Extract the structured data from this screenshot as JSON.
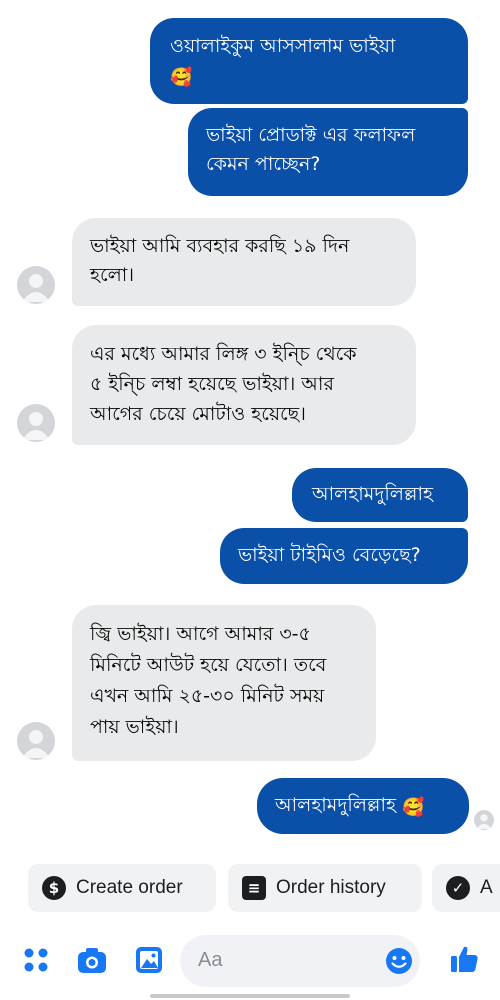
{
  "messages": [
    {
      "dir": "out",
      "text": "ওয়ালাইকুম আসসালাম ভাইয়া",
      "emoji": "🥰"
    },
    {
      "dir": "out",
      "lines": [
        "ভাইয়া প্রোডাক্ট এর ফলাফল",
        "কেমন পাচ্ছেন?"
      ]
    },
    {
      "dir": "in",
      "lines": [
        "ভাইয়া আমি ব্যবহার করছি ১৯ দিন",
        "হলো।"
      ]
    },
    {
      "dir": "in",
      "lines": [
        "এর মধ্যে আমার লিঙ্গ ৩ ইন্চি থেকে",
        "৫ ইন্চি লম্বা হয়েছে ভাইয়া। আর",
        "আগের চেয়ে মোটাও হয়েছে।"
      ]
    },
    {
      "dir": "out",
      "text": "আলহামদুলিল্লাহ"
    },
    {
      "dir": "out",
      "text": "ভাইয়া টাইমিও বেড়েছে?"
    },
    {
      "dir": "in",
      "lines": [
        "জ্বি ভাইয়া। আগে আমার ৩-৫",
        "মিনিটে আউট হয়ে যেতো। তবে",
        "এখন আমি ২৫-৩০ মিনিট সময়",
        "পায় ভাইয়া।"
      ]
    },
    {
      "dir": "out",
      "text": "আলহামদুলিল্লাহ",
      "emoji": "🥰"
    }
  ],
  "quick_actions": [
    {
      "label": "Create order",
      "icon": "dollar-icon",
      "glyph": "$"
    },
    {
      "label": "Order history",
      "icon": "receipt-icon",
      "glyph": "≡"
    },
    {
      "label": "A",
      "icon": "check-circle-icon",
      "glyph": "✓"
    }
  ],
  "composer": {
    "placeholder": "Aa",
    "icons": [
      "apps-icon",
      "camera-icon",
      "gallery-icon",
      "emoji-icon",
      "like-icon"
    ]
  },
  "colors": {
    "outgoing_bubble": "#0a4fa8",
    "incoming_bubble": "#e9eaec",
    "accent": "#1877f2"
  }
}
